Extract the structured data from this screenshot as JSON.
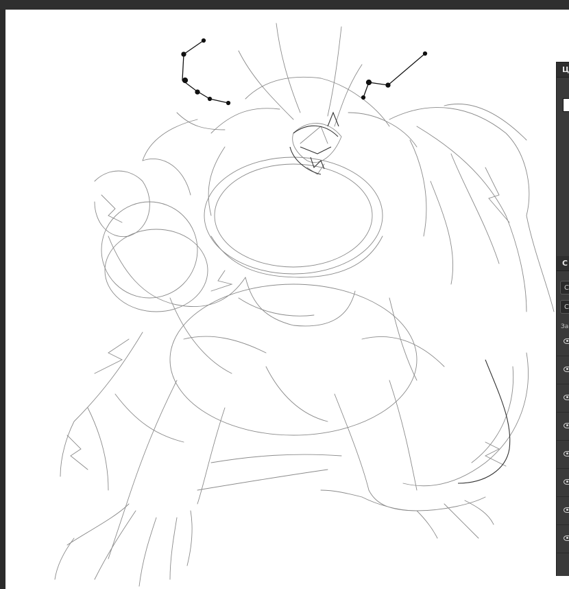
{
  "window": {
    "title": ""
  },
  "canvas": {
    "background": "#ffffff",
    "sketch_color": "#6a6a6a",
    "stroke_color": "#111111"
  },
  "panels": {
    "color": {
      "title": "Ц"
    },
    "layers": {
      "title": "С",
      "blend_mode": "С",
      "opacity_field": "С",
      "lock_label": "За",
      "layers": [
        {
          "visible": true
        },
        {
          "visible": true
        },
        {
          "visible": true
        },
        {
          "visible": true
        },
        {
          "visible": true
        },
        {
          "visible": true
        },
        {
          "visible": true
        },
        {
          "visible": true
        }
      ]
    }
  },
  "icons": {
    "layer_visibility": "eye-icon"
  }
}
